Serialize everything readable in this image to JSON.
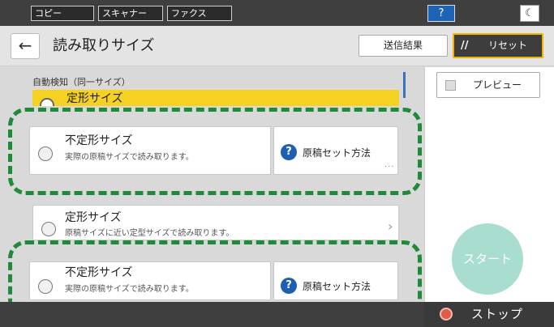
{
  "top_tabs": [
    "コピー",
    "スキャナー",
    "ファクス"
  ],
  "help_label": "?",
  "header": {
    "title": "読み取りサイズ",
    "result_label": "送信結果",
    "reset_label": "リセット"
  },
  "list": {
    "section_label": "自動検知（同一サイズ）",
    "highlighted_item": "定形サイズ",
    "items": [
      {
        "title": "不定形サイズ",
        "desc": "実際の原稿サイズで読み取ります。",
        "how": "原稿セット方法"
      },
      {
        "title": "定形サイズ",
        "desc": "原稿サイズに近い定型サイズで読み取ります。"
      },
      {
        "title": "不定形サイズ",
        "desc": "実際の原稿サイズで読み取ります。",
        "how": "原稿セット方法"
      }
    ]
  },
  "right": {
    "preview_label": "プレビュー",
    "start_label": "スタート",
    "stop_label": "ストップ"
  },
  "colors": {
    "highlight": "#f5d122",
    "callout": "#1f8a3a",
    "accent_blue": "#1e5fb3",
    "start": "#a8ddd0"
  }
}
